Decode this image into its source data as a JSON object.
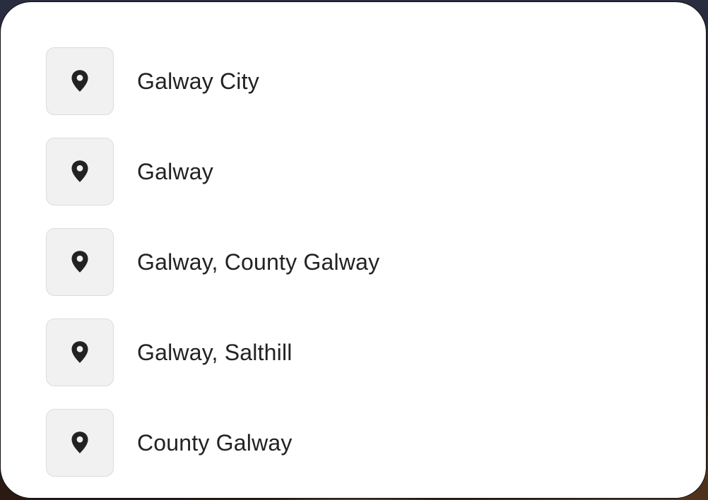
{
  "suggestions": [
    {
      "label": "Galway City",
      "icon": "map-pin-icon"
    },
    {
      "label": "Galway",
      "icon": "map-pin-icon"
    },
    {
      "label": "Galway, County Galway",
      "icon": "map-pin-icon"
    },
    {
      "label": "Galway, Salthill",
      "icon": "map-pin-icon"
    },
    {
      "label": "County Galway",
      "icon": "map-pin-icon"
    }
  ],
  "colors": {
    "text": "#222222",
    "icon": "#222222",
    "icon_box_bg": "#f1f1f1",
    "icon_box_border": "#dcdcdc",
    "panel_bg": "#ffffff"
  }
}
